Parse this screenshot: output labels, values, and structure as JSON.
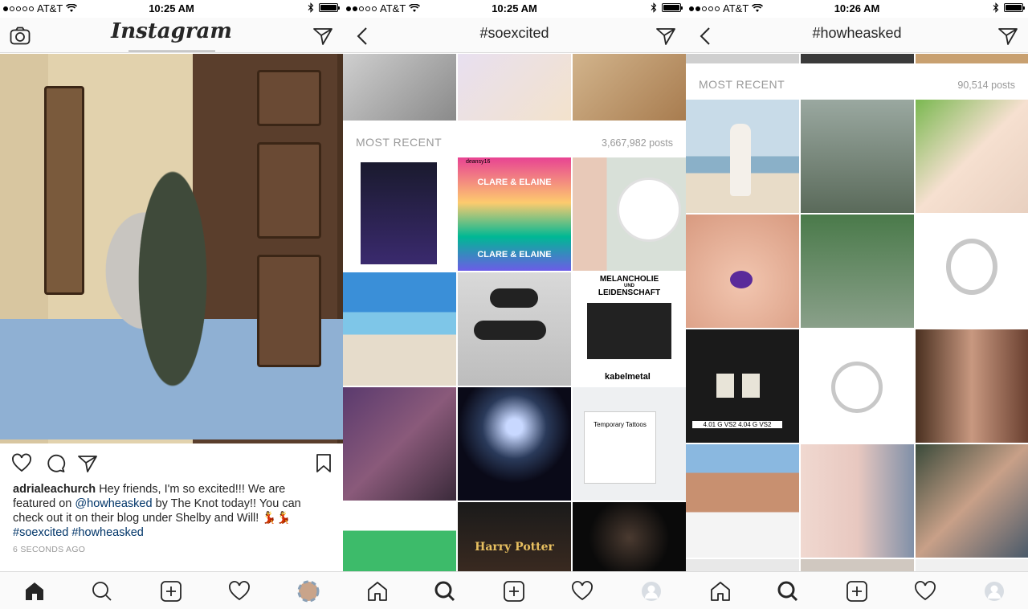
{
  "status_bars": [
    {
      "carrier": "AT&T",
      "time": "10:25 AM"
    },
    {
      "carrier": "AT&T",
      "time": "10:25 AM"
    },
    {
      "carrier": "AT&T",
      "time": "10:26 AM"
    }
  ],
  "feed": {
    "app_title": "Instagram",
    "post": {
      "username": "adrialeachurch",
      "caption_part1": " Hey friends, I'm so excited!!! We are featured on ",
      "mention": "@howheasked",
      "caption_part2": " by The Knot today!! You can check out it on their blog under Shelby and Will! 💃💃",
      "hashtag1": "#soexcited",
      "hashtag2": "#howheasked",
      "time_ago": "6 SECONDS AGO"
    }
  },
  "tag1": {
    "title": "#soexcited",
    "section_label": "MOST RECENT",
    "post_count": "3,667,982 posts",
    "tile_texts": {
      "wristband_user": "deansy16",
      "wristband": "CLARE & ELAINE",
      "poster_title1": "MELANCHOLIE",
      "poster_und": "UND",
      "poster_title2": "LEIDENSCHAFT",
      "poster_brand": "kabelmetal",
      "tattoo": "Temporary Tattoos",
      "harry_potter": "Harry Potter"
    }
  },
  "tag2": {
    "title": "#howheasked",
    "section_label": "MOST RECENT",
    "post_count": "90,514 posts",
    "tile_texts": {
      "diamonds": "4.01 G VS2 4.04 G VS2"
    }
  },
  "icons": {
    "camera": "camera-icon",
    "direct": "direct-message-icon",
    "back": "back-chevron-icon",
    "home": "home-icon",
    "search": "search-icon",
    "add": "add-post-icon",
    "heart": "heart-icon",
    "comment": "comment-icon",
    "bookmark": "bookmark-icon"
  },
  "colors": {
    "link": "#003569",
    "muted": "#999999",
    "bar_bg": "#fafafa",
    "border": "#dbdbdb"
  }
}
